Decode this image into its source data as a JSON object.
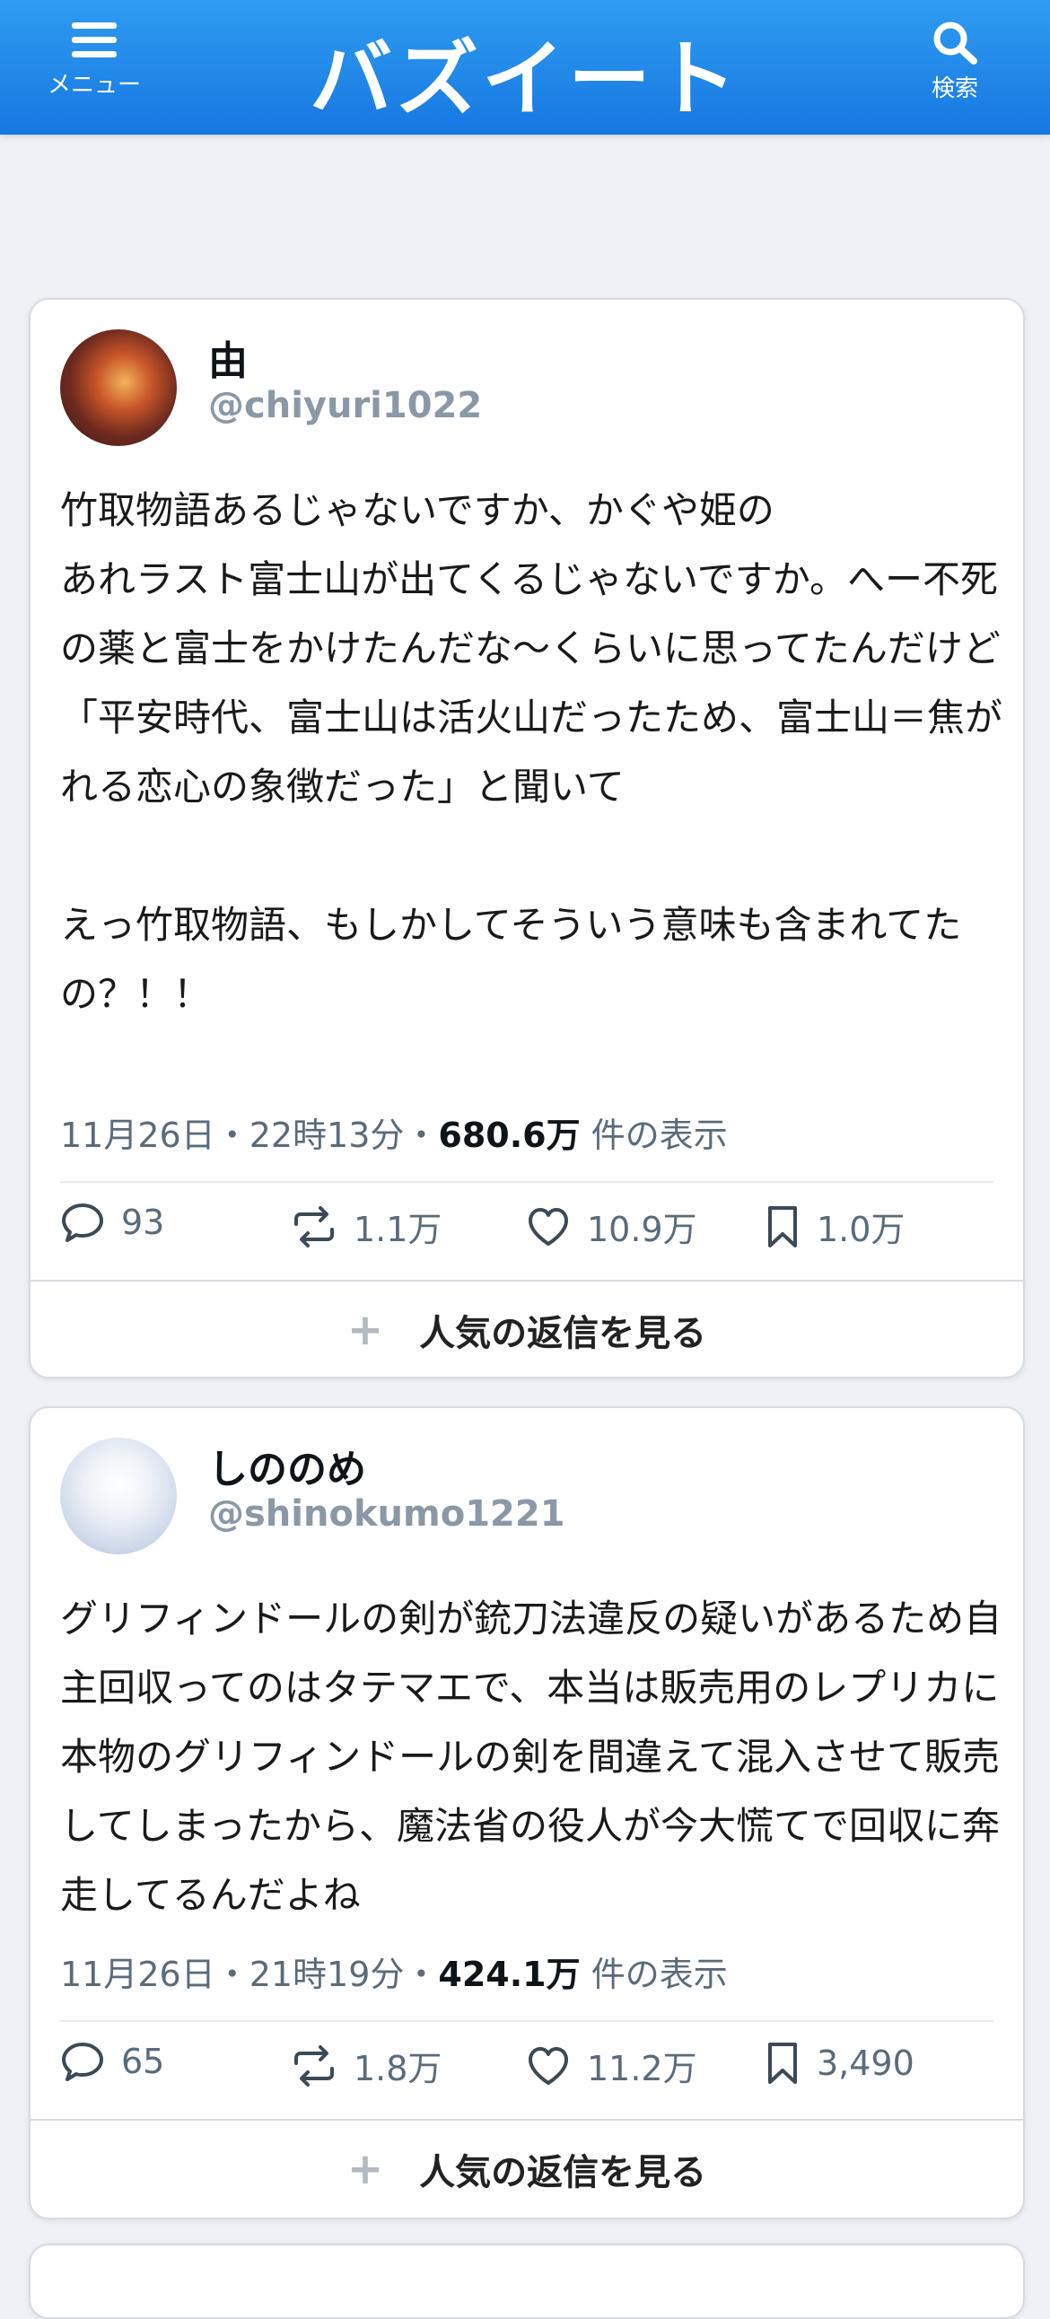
{
  "header": {
    "menu_label": "メニュー",
    "logo_text": "バズイート",
    "search_label": "検索",
    "color": "#1d84ea"
  },
  "posts": [
    {
      "name": "由",
      "handle": "@chiyuri1022",
      "text": "竹取物語あるじゃないですか、かぐや姫の\nあれラスト富士山が出てくるじゃないですか。へー不死の薬と富士をかけたんだな〜くらいに思ってたんだけど\n「平安時代、富士山は活火山だったため、富士山＝焦がれる恋心の象徴だった」と聞いて\n\nえっ竹取物語、もしかしてそういう意味も含まれてたの？！！",
      "date": "11月26日・22時13分・",
      "views": "680.6万",
      "views_suffix": " 件の表示",
      "replies": "93",
      "retweets": "1.1万",
      "likes": "10.9万",
      "bookmarks": "1.0万",
      "popular_replies": "人気の返信を見る"
    },
    {
      "name": "しののめ",
      "handle": "@shinokumo1221",
      "text": "グリフィンドールの剣が銃刀法違反の疑いがあるため自主回収ってのはタテマエで、本当は販売用のレプリカに本物のグリフィンドールの剣を間違えて混入させて販売してしまったから、魔法省の役人が今大慌てで回収に奔走してるんだよね",
      "date": "11月26日・21時19分・",
      "views": "424.1万",
      "views_suffix": " 件の表示",
      "replies": "65",
      "retweets": "1.8万",
      "likes": "11.2万",
      "bookmarks": "3,490",
      "popular_replies": "人気の返信を見る"
    }
  ]
}
